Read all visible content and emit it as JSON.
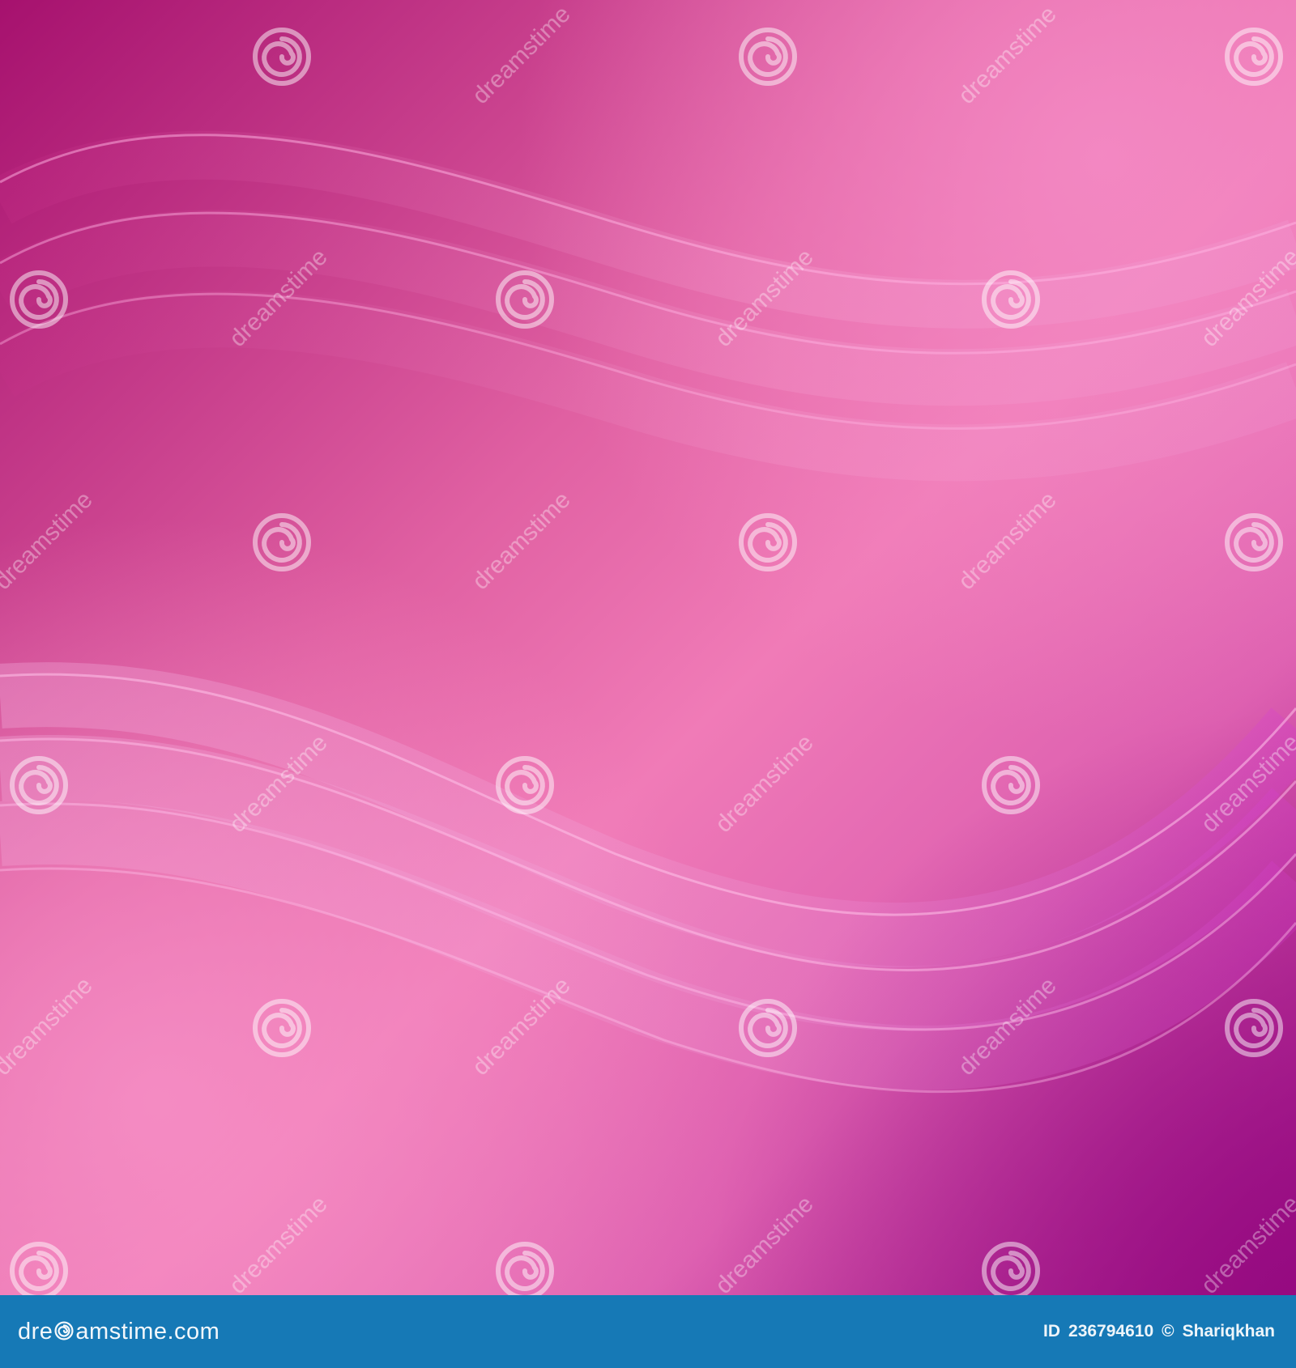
{
  "image": {
    "colors": {
      "bg_dark": "#a6116e",
      "bg_mid": "#e060a2",
      "bg_light": "#f27ab6",
      "bg_purple": "#9c0f88",
      "wave_highlight": "#f7b0e0",
      "wave_magenta": "#e040d8",
      "footer": "#1679b6"
    },
    "watermark_text": "dreamstime",
    "watermark_icon": "spiral-icon"
  },
  "footer": {
    "brand_prefix": "dre",
    "brand_suffix": "amstime.com",
    "brand_icon": "spiral-icon",
    "id_label": "ID",
    "id_number": "236794610",
    "copyright_symbol": "©",
    "author": "Shariqkhan"
  }
}
